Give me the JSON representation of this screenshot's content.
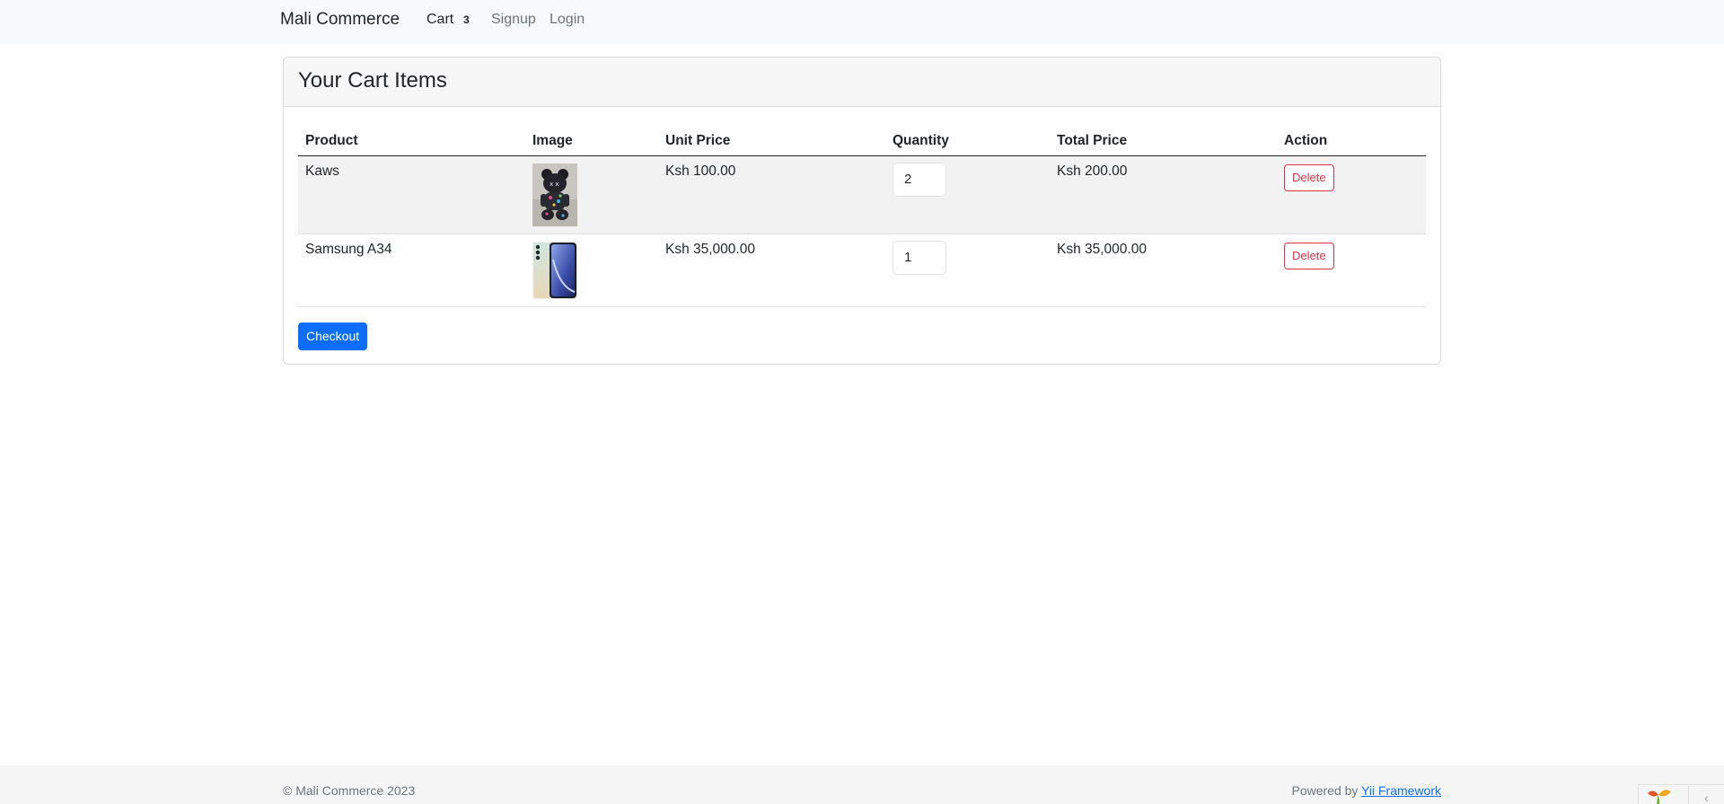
{
  "navbar": {
    "brand": "Mali Commerce",
    "cart_label": "Cart",
    "cart_count": "3",
    "signup_label": "Signup",
    "login_label": "Login"
  },
  "card": {
    "title": "Your Cart Items"
  },
  "table": {
    "headers": [
      "Product",
      "Image",
      "Unit Price",
      "Quantity",
      "Total Price",
      "Action"
    ],
    "rows": [
      {
        "product": "Kaws",
        "image_icon": "kaws-figure-image",
        "unit_price": "Ksh 100.00",
        "quantity": "2",
        "total_price": "Ksh 200.00",
        "action": "Delete"
      },
      {
        "product": "Samsung A34",
        "image_icon": "samsung-phone-image",
        "unit_price": "Ksh 35,000.00",
        "quantity": "1",
        "total_price": "Ksh 35,000.00",
        "action": "Delete"
      }
    ]
  },
  "checkout_label": "Checkout",
  "footer": {
    "copyright": "© Mali Commerce 2023",
    "powered_prefix": "Powered by",
    "powered_link": "Yii Framework"
  },
  "colors": {
    "primary": "#0d6efd",
    "danger": "#dc3545",
    "navbar_bg": "#f8f9fa",
    "stripe_bg": "#f2f2f2"
  }
}
